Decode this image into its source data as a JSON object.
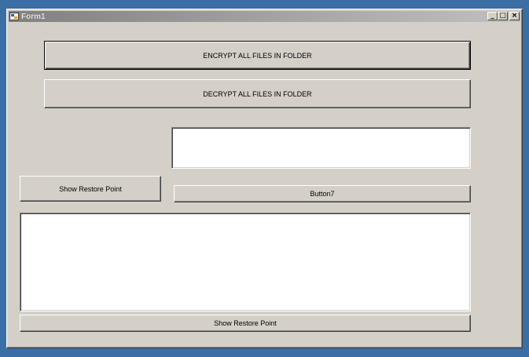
{
  "window": {
    "title": "Form1",
    "controls": {
      "minimize": "_",
      "maximize": "□",
      "close": "×"
    }
  },
  "buttons": {
    "encrypt": "ENCRYPT ALL FILES IN FOLDER",
    "decrypt": "DECRYPT ALL FILES IN FOLDER",
    "show_restore_point_left": "Show Restore Point",
    "button7": "Button7",
    "show_restore_point_bottom": "Show Restore Point"
  },
  "fields": {
    "top_textbox": {
      "value": "",
      "placeholder": ""
    },
    "large_textbox": {
      "value": "",
      "placeholder": ""
    }
  },
  "colors": {
    "desktop": "#3a6ea5",
    "window_face": "#d4d0c8",
    "titlebar_inactive": "#808080"
  }
}
